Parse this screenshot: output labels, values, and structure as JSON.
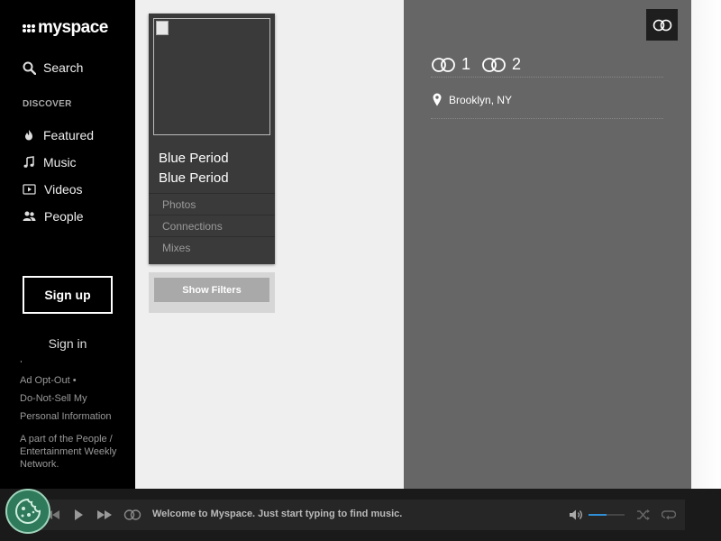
{
  "sidebar": {
    "logo_text": "myspace",
    "search_label": "Search",
    "discover_label": "DISCOVER",
    "nav": [
      {
        "label": "Featured",
        "icon": "flame-icon"
      },
      {
        "label": "Music",
        "icon": "music-note-icon"
      },
      {
        "label": "Videos",
        "icon": "video-icon"
      },
      {
        "label": "People",
        "icon": "people-icon"
      }
    ],
    "signup_label": "Sign up",
    "signin_label": "Sign in",
    "footer_links": [
      "Ad Opt-Out",
      "Do-Not-Sell My Personal Information"
    ],
    "footer_note": "A part of the People / Entertainment Weekly Network."
  },
  "profile": {
    "name_line1": "Blue Period",
    "name_line2": "Blue Period",
    "tabs": [
      "Photos",
      "Connections",
      "Mixes"
    ],
    "show_filters_label": "Show Filters"
  },
  "panel": {
    "connections_in": "1",
    "connections_out": "2",
    "location": "Brooklyn, NY"
  },
  "player": {
    "message": "Welcome to Myspace. Just start typing to find music.",
    "volume_fraction": 0.5
  },
  "colors": {
    "accent": "#2e8fd6",
    "sidebar_bg": "#000000",
    "panel_bg": "#666666"
  }
}
